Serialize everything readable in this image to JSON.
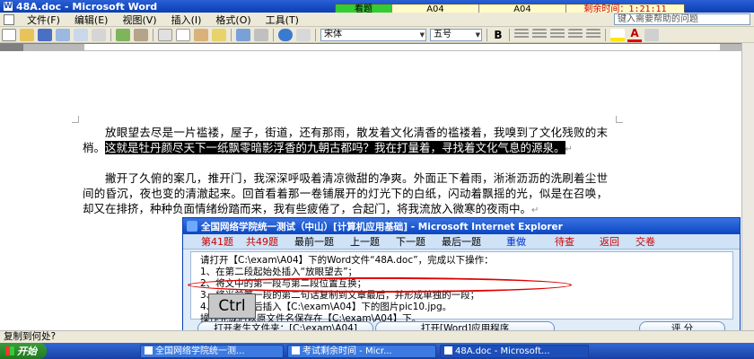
{
  "window": {
    "title": "48A.doc - Microsoft Word",
    "icon_letter": "W"
  },
  "menu": {
    "items": [
      "文件(F)",
      "编辑(E)",
      "视图(V)",
      "插入(I)",
      "格式(O)",
      "工具(T)"
    ],
    "help_search_placeholder": "键入需要帮助的问题"
  },
  "timer": {
    "status": "看题",
    "cells": [
      "A04",
      "A04"
    ],
    "remaining": "剩余时间：1:21:11",
    "status_color": "#33cc33"
  },
  "toolbar": {
    "font_name": "宋体",
    "font_size": "五号",
    "bold": "B",
    "font_color_letter": "A"
  },
  "document": {
    "para1_before": "放眼望去尽是一片褴褛，屋子，街道，还有那雨，散发着文化清香的褴褛着，我嗅到了文化残败的末梢。",
    "para1_highlight": "这就是牡丹颜尽天下一纸飘零暗影浮香的九朝古都吗？我在打量着，寻找着文化气息的源泉。",
    "para2": "撇开了久俯的案几，推开门，我深深呼吸着清凉微甜的净爽。外面正下着雨，淅淅沥沥的洗刷着尘世间的昏沉，夜也变的清澈起来。回首看着那一卷铺展开的灯光下的白纸，闪动着飘摇的光，似是在召唤，却又在排挤，种种负面情绪纷踏而来，我有些疲倦了，合起门，将我流放入微寒的夜雨中。",
    "para_mark": "↵"
  },
  "exam": {
    "title": "全国网络学院统一测试（中山）[计算机应用基础] - Microsoft Internet Explorer",
    "question_label": "第41题",
    "total_label": "共49题",
    "nav": [
      "最前一题",
      "上一题",
      "下一题",
      "最后一题"
    ],
    "actions_blue": [
      "重做"
    ],
    "actions_red": [
      "待查",
      "返回",
      "交卷"
    ],
    "lines": [
      "请打开【C:\\exam\\A04】下的Word文件“48A.doc”，完成以下操作：",
      "1、在第二段起始处插入“放眼望去”；",
      "2、将文中的第一段与第二段位置互换；",
      "3、将当前第一段的第二句话复制到文章最后，并形成单独的一段；",
      "4、在文章最后插入【C:\\exam\\A04】下的图片pic10.jpg。",
      "操作完成后以原文件名保存在【C:\\exam\\A04】下。"
    ],
    "key_hint": "Ctrl",
    "btn_open_folder": "打开考生文件夹：[C:\\exam\\A04]",
    "btn_open_word": "打开[Word]应用程序",
    "btn_score": "评  分"
  },
  "status_bar": {
    "text": "复制到何处?"
  },
  "taskbar": {
    "start": "开始",
    "items": [
      "全国网络学院统一测...",
      "考试剩余时间 - Micr...",
      "48A.doc - Microsoft..."
    ]
  }
}
